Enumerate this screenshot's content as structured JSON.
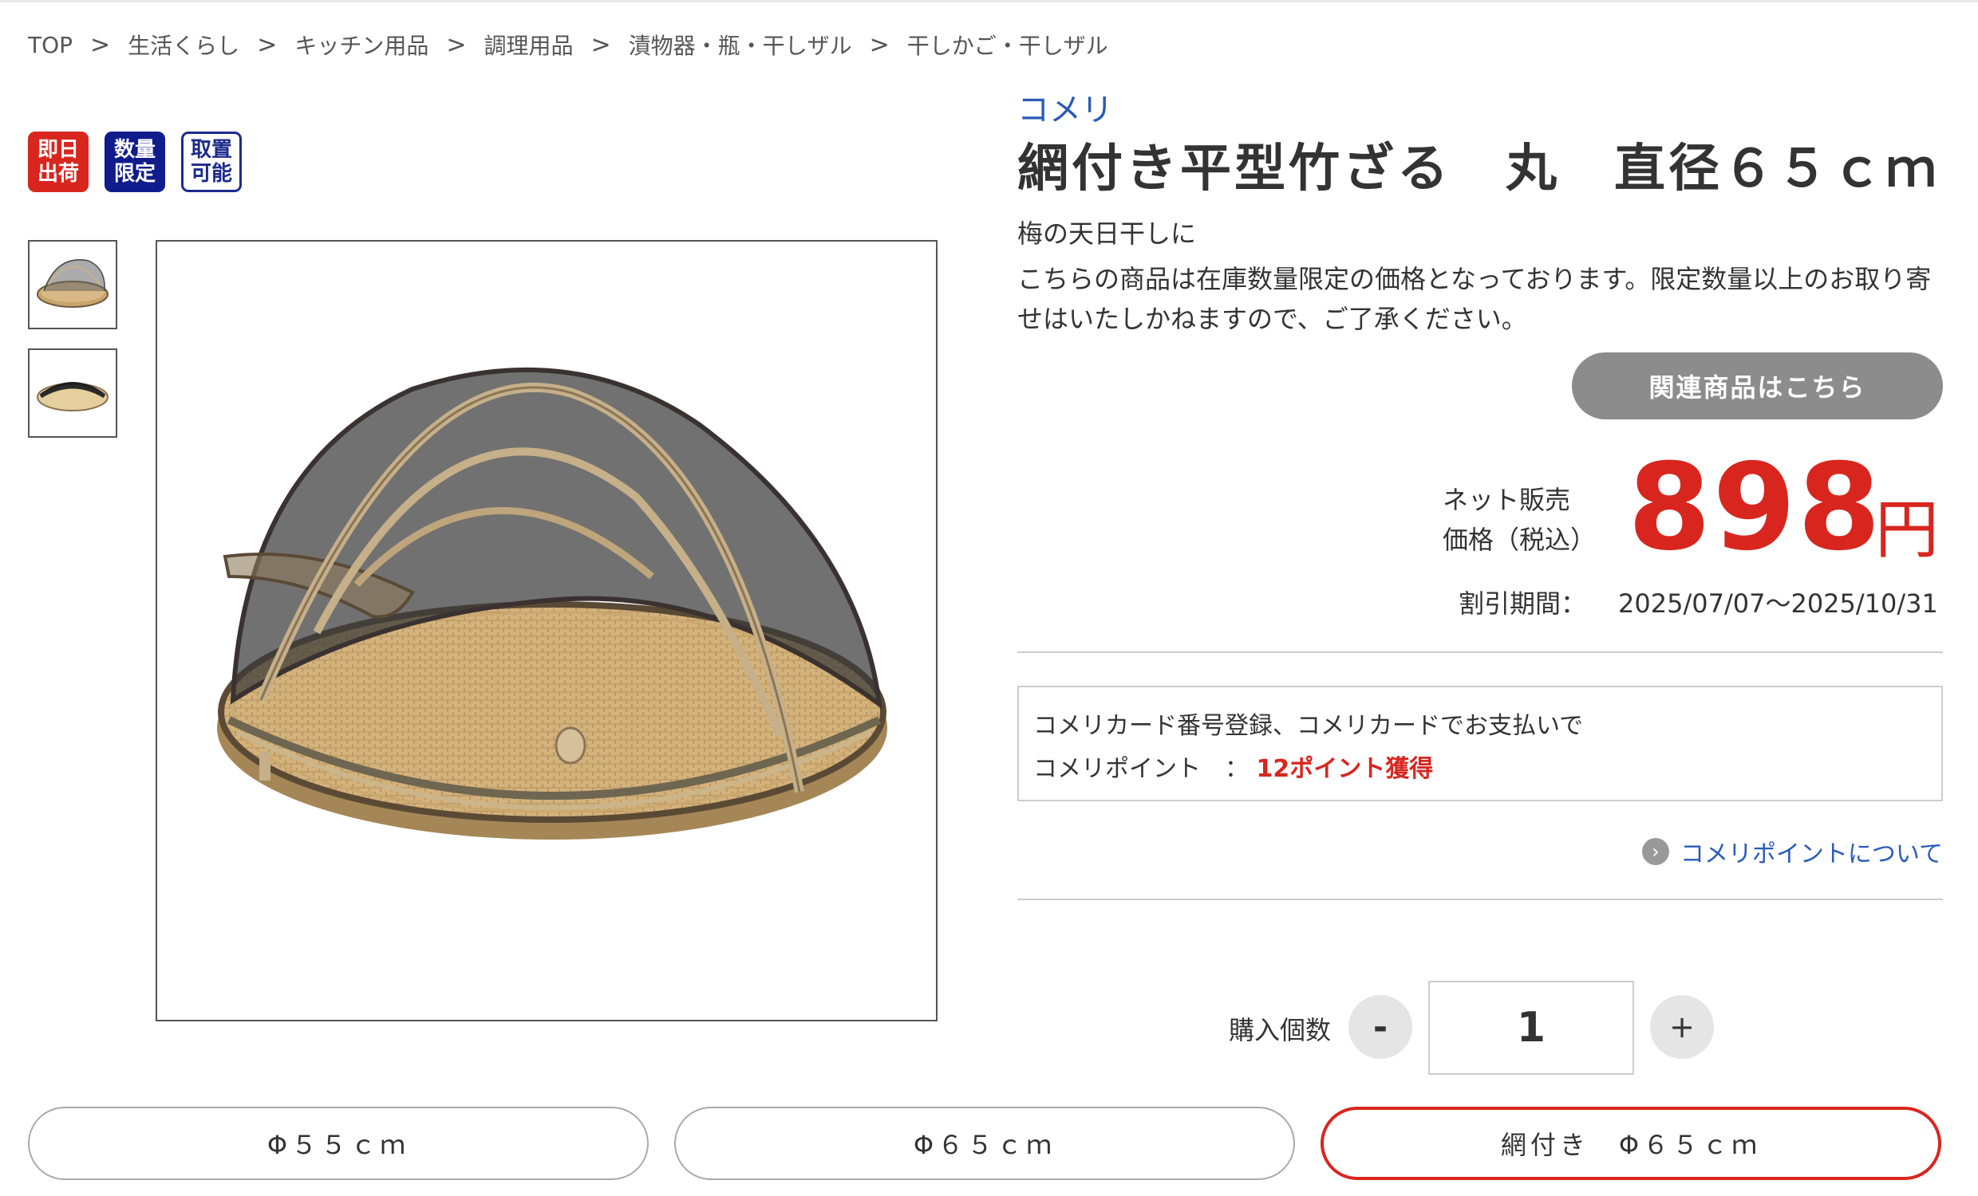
{
  "breadcrumb": {
    "items": [
      "TOP",
      "生活くらし",
      "キッチン用品",
      "調理用品",
      "漬物器・瓶・干しザル",
      "干しかご・干しザル"
    ],
    "separator": ">"
  },
  "badges": [
    {
      "line1": "即日",
      "line2": "出荷",
      "color": "#d8261f"
    },
    {
      "line1": "数量",
      "line2": "限定",
      "color": "#101c8c"
    },
    {
      "line1": "取置",
      "line2": "可能",
      "color": "#1d2b8c"
    }
  ],
  "product": {
    "brand": "コメリ",
    "title": "網付き平型竹ざる　丸　直径６５ｃｍ",
    "catch": "梅の天日干しに",
    "notice": "こちらの商品は在庫数量限定の価格となっております。限定数量以上のお取り寄せはいたしかねますので、ご了承ください。"
  },
  "related_button": "関連商品はこちら",
  "price": {
    "label_line1": "ネット販売",
    "label_line2": "価格（税込）",
    "value": "898",
    "unit": "円",
    "color": "#d8261f"
  },
  "discount": {
    "label": "割引期間：",
    "period": "2025/07/07〜2025/10/31"
  },
  "points": {
    "line1": "コメリカード番号登録、コメリカードでお支払いで",
    "label": "コメリポイント　：",
    "value": "12ポイント獲得",
    "link": "コメリポイントについて"
  },
  "quantity": {
    "label": "購入個数",
    "minus": "-",
    "value": "1",
    "plus": "+"
  },
  "variants": [
    {
      "label": "Φ５５ｃｍ",
      "selected": false
    },
    {
      "label": "Φ６５ｃｍ",
      "selected": false
    },
    {
      "label": "網付き　Φ６５ｃｍ",
      "selected": true
    }
  ]
}
